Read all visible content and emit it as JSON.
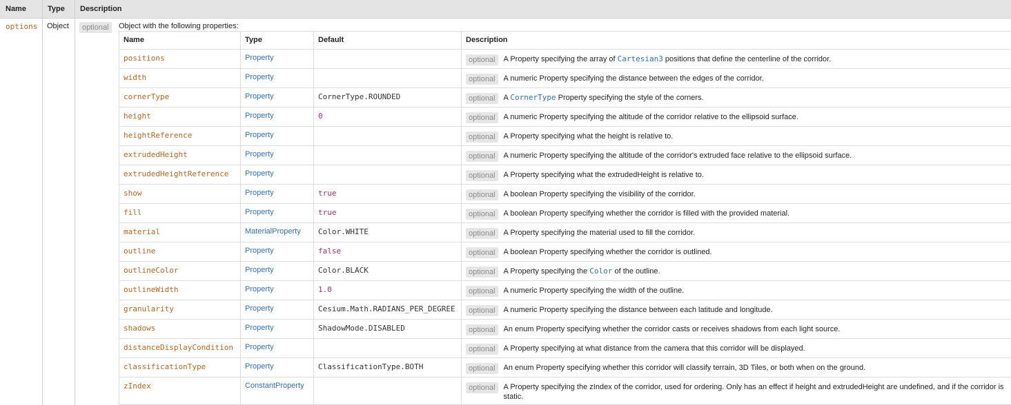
{
  "header": {
    "name": "Name",
    "type": "Type",
    "description": "Description"
  },
  "param": {
    "name": "options",
    "type": "Object",
    "optional_badge": "optional",
    "description": "Object with the following properties:"
  },
  "inner_header": {
    "name": "Name",
    "type": "Type",
    "default": "Default",
    "description": "Description"
  },
  "badge_label": "optional",
  "rows": [
    {
      "name": "positions",
      "type": "Property",
      "default": "",
      "desc_pre": "A Property specifying the array of ",
      "desc_link": "Cartesian3",
      "desc_post": " positions that define the centerline of the corridor."
    },
    {
      "name": "width",
      "type": "Property",
      "default": "",
      "desc_pre": "A numeric Property specifying the distance between the edges of the corridor.",
      "desc_link": "",
      "desc_post": ""
    },
    {
      "name": "cornerType",
      "type": "Property",
      "default": "CornerType.ROUNDED",
      "desc_pre": "A ",
      "desc_link": "CornerType",
      "desc_post": " Property specifying the style of the corners."
    },
    {
      "name": "height",
      "type": "Property",
      "default": "0",
      "desc_pre": "A numeric Property specifying the altitude of the corridor relative to the ellipsoid surface.",
      "desc_link": "",
      "desc_post": ""
    },
    {
      "name": "heightReference",
      "type": "Property",
      "default": "",
      "desc_pre": "A Property specifying what the height is relative to.",
      "desc_link": "",
      "desc_post": ""
    },
    {
      "name": "extrudedHeight",
      "type": "Property",
      "default": "",
      "desc_pre": "A numeric Property specifying the altitude of the corridor's extruded face relative to the ellipsoid surface.",
      "desc_link": "",
      "desc_post": ""
    },
    {
      "name": "extrudedHeightReference",
      "type": "Property",
      "default": "",
      "desc_pre": "A Property specifying what the extrudedHeight is relative to.",
      "desc_link": "",
      "desc_post": ""
    },
    {
      "name": "show",
      "type": "Property",
      "default": "true",
      "desc_pre": "A boolean Property specifying the visibility of the corridor.",
      "desc_link": "",
      "desc_post": ""
    },
    {
      "name": "fill",
      "type": "Property",
      "default": "true",
      "desc_pre": "A boolean Property specifying whether the corridor is filled with the provided material.",
      "desc_link": "",
      "desc_post": ""
    },
    {
      "name": "material",
      "type": "MaterialProperty",
      "default": "Color.WHITE",
      "desc_pre": "A Property specifying the material used to fill the corridor.",
      "desc_link": "",
      "desc_post": ""
    },
    {
      "name": "outline",
      "type": "Property",
      "default": "false",
      "desc_pre": "A boolean Property specifying whether the corridor is outlined.",
      "desc_link": "",
      "desc_post": ""
    },
    {
      "name": "outlineColor",
      "type": "Property",
      "default": "Color.BLACK",
      "desc_pre": "A Property specifying the ",
      "desc_link": "Color",
      "desc_post": " of the outline."
    },
    {
      "name": "outlineWidth",
      "type": "Property",
      "default": "1.0",
      "desc_pre": "A numeric Property specifying the width of the outline.",
      "desc_link": "",
      "desc_post": ""
    },
    {
      "name": "granularity",
      "type": "Property",
      "default": "Cesium.Math.RADIANS_PER_DEGREE",
      "desc_pre": "A numeric Property specifying the distance between each latitude and longitude.",
      "desc_link": "",
      "desc_post": ""
    },
    {
      "name": "shadows",
      "type": "Property",
      "default": "ShadowMode.DISABLED",
      "desc_pre": "An enum Property specifying whether the corridor casts or receives shadows from each light source.",
      "desc_link": "",
      "desc_post": ""
    },
    {
      "name": "distanceDisplayCondition",
      "type": "Property",
      "default": "",
      "desc_pre": "A Property specifying at what distance from the camera that this corridor will be displayed.",
      "desc_link": "",
      "desc_post": ""
    },
    {
      "name": "classificationType",
      "type": "Property",
      "default": "ClassificationType.BOTH",
      "desc_pre": "An enum Property specifying whether this corridor will classify terrain, 3D Tiles, or both when on the ground.",
      "desc_link": "",
      "desc_post": ""
    },
    {
      "name": "zIndex",
      "type": "ConstantProperty",
      "default": "",
      "desc_pre": "A Property specifying the zIndex of the corridor, used for ordering. Only has an effect if height and extrudedHeight are undefined, and if the corridor is static.",
      "desc_link": "",
      "desc_post": ""
    }
  ],
  "literal_defaults": [
    "0",
    "true",
    "false",
    "1.0"
  ],
  "colors": {
    "name": "#b6651f",
    "type_link": "#2e6fb8",
    "literal": "#a12d6b",
    "header_bg": "#e4e4e4",
    "badge_bg": "#e6e6e6",
    "badge_text": "#8a8a8a"
  }
}
